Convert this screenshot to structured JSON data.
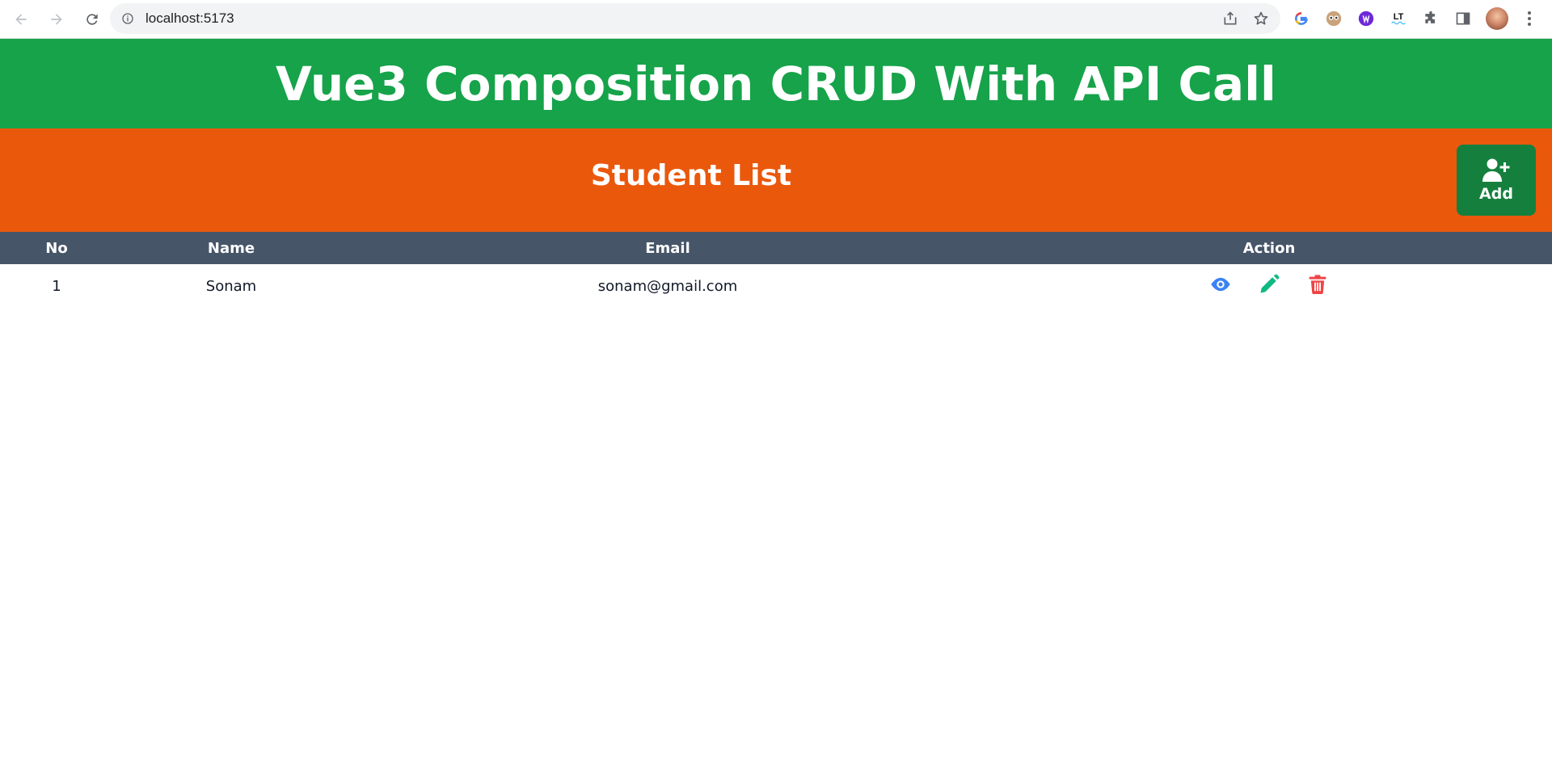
{
  "browser": {
    "url": "localhost:5173",
    "icons": [
      "back-icon",
      "forward-icon",
      "reload-icon",
      "site-info-icon",
      "share-icon",
      "bookmark-star-icon",
      "extensions-puzzle-icon",
      "side-panel-icon",
      "menu-kebab-icon"
    ],
    "extensions": [
      "LT"
    ]
  },
  "header": {
    "title": "Vue3 Composition CRUD With API Call",
    "color": "#16a34a"
  },
  "list_bar": {
    "title": "Student List",
    "add_label": "Add",
    "color": "#ea580c",
    "add_color": "#15803d"
  },
  "table": {
    "header_color": "#475569",
    "columns": [
      "No",
      "Name",
      "Email",
      "Action"
    ],
    "rows": [
      {
        "no": "1",
        "name": "Sonam",
        "email": "sonam@gmail.com",
        "actions": [
          "view-icon",
          "edit-icon",
          "delete-icon"
        ]
      }
    ]
  },
  "colors": {
    "view": "#3b82f6",
    "edit": "#10b981",
    "delete": "#ef4444"
  }
}
